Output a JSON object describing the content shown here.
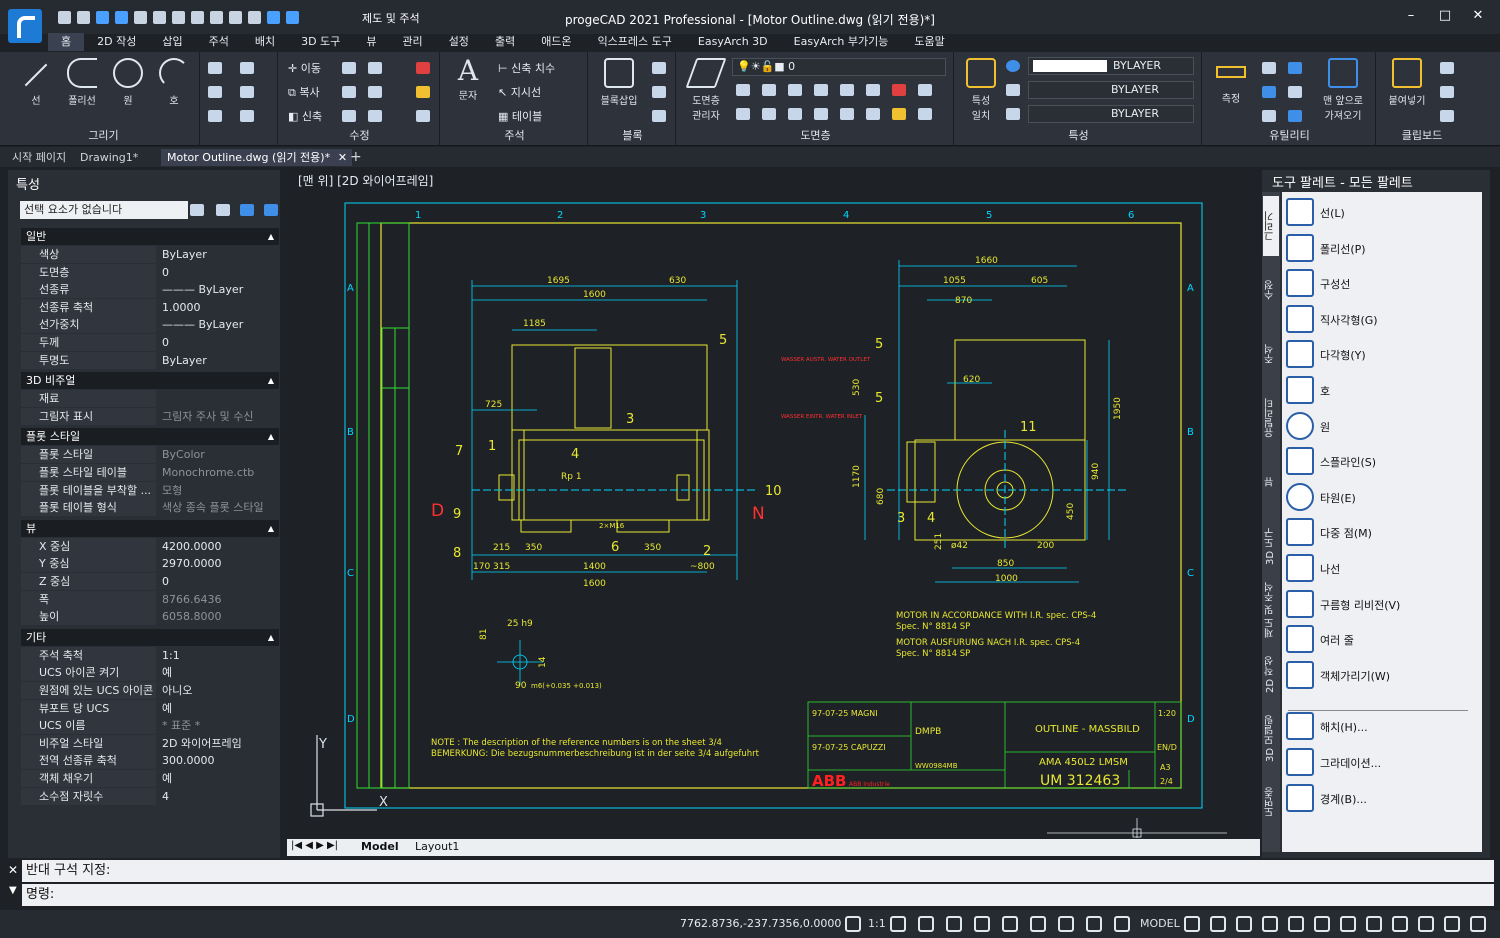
{
  "titlebar": {
    "app_title": "progeCAD 2021 Professional - [Motor Outline.dwg (읽기 전용)*]",
    "quick_label": "제도 및 주석",
    "minimize": "–",
    "maximize": "□",
    "close": "✕"
  },
  "menu_tabs": [
    "홈",
    "2D 작성",
    "삽입",
    "주석",
    "배치",
    "3D 도구",
    "뷰",
    "관리",
    "설정",
    "출력",
    "애드온",
    "익스프레스 도구",
    "EasyArch 3D",
    "EasyArch 부가기능",
    "도움말"
  ],
  "ribbon": {
    "draw": {
      "title": "그리기",
      "line": "선",
      "polyline": "폴리선",
      "circle": "원",
      "arc": "호"
    },
    "modify": {
      "title": "수정",
      "move": "이동",
      "copy": "복사",
      "stretch": "신축"
    },
    "annotation": {
      "title": "주석",
      "text": "문자",
      "dim": "신축 치수",
      "leader": "지시선",
      "table": "테이블"
    },
    "block": {
      "title": "블록",
      "insert": "블록삽입"
    },
    "layers": {
      "title": "도면층",
      "manager": "도면층\n관리자",
      "current": "0"
    },
    "properties": {
      "title": "특성",
      "match": "특성\n일치",
      "color": "BYLAYER",
      "linetype": "BYLAYER",
      "lineweight": "BYLAYER"
    },
    "utilities": {
      "title": "유틸리티",
      "measure": "측정",
      "paste_from": "맨 앞으로\n가져오기"
    },
    "clipboard": {
      "title": "클립보드",
      "paste": "붙여넣기"
    }
  },
  "doc_tabs": [
    "시작 페이지",
    "Drawing1*",
    "Motor Outline.dwg (읽기 전용)*"
  ],
  "properties": {
    "title": "특성",
    "selection": "선택 요소가 없습니다",
    "sections": [
      {
        "name": "일반",
        "rows": [
          [
            "색상",
            "ByLayer"
          ],
          [
            "도면층",
            "0"
          ],
          [
            "선종류",
            "——— ByLayer"
          ],
          [
            "선종류 축척",
            "1.0000"
          ],
          [
            "선가중치",
            "——— ByLayer"
          ],
          [
            "두께",
            "0"
          ],
          [
            "투명도",
            "ByLayer"
          ]
        ]
      },
      {
        "name": "3D 비주얼",
        "rows": [
          [
            "재료",
            ""
          ],
          [
            "그림자 표시",
            "그림자 주사 및 수신"
          ]
        ]
      },
      {
        "name": "플롯 스타일",
        "rows": [
          [
            "플롯 스타일",
            "ByColor"
          ],
          [
            "플롯 스타일 테이블",
            "Monochrome.ctb"
          ],
          [
            "플롯 테이블을 부착할 ...",
            "모형"
          ],
          [
            "플롯 테이블 형식",
            "색상 종속 플롯 스타일"
          ]
        ]
      },
      {
        "name": "뷰",
        "rows": [
          [
            "X 중심",
            "4200.0000"
          ],
          [
            "Y 중심",
            "2970.0000"
          ],
          [
            "Z 중심",
            "0"
          ],
          [
            "폭",
            "8766.6436"
          ],
          [
            "높이",
            "6058.8000"
          ]
        ]
      },
      {
        "name": "기타",
        "rows": [
          [
            "주석 축척",
            "1:1"
          ],
          [
            "UCS 아이콘 켜기",
            "예"
          ],
          [
            "원점에 있는 UCS 아이콘",
            "아니오"
          ],
          [
            "뷰포트 당 UCS",
            "예"
          ],
          [
            "UCS 이름",
            "* 표준 *"
          ],
          [
            "비주얼 스타일",
            "2D 와이어프레임"
          ],
          [
            "전역 선종류 축척",
            "300.0000"
          ],
          [
            "객체 채우기",
            "예"
          ],
          [
            "소수점 자릿수",
            "4"
          ]
        ]
      }
    ]
  },
  "viewport": {
    "label": "[맨 위] [2D 와이어프레임]"
  },
  "drawing": {
    "zone_numbers": [
      "1",
      "2",
      "3",
      "4",
      "5",
      "6"
    ],
    "zone_letters": [
      "A",
      "B",
      "C",
      "D"
    ],
    "dims_front": [
      "1695",
      "630",
      "1600",
      "1185",
      "725",
      "215",
      "350",
      "350",
      "170",
      "315",
      "1400",
      "1600",
      "~800"
    ],
    "dims_side": [
      "1660",
      "1055",
      "605",
      "870",
      "620",
      "530",
      "1950",
      "1170",
      "680",
      "940",
      "450",
      "251",
      "ø42",
      "200",
      "850",
      "1000"
    ],
    "callouts_front": [
      "5",
      "3",
      "4",
      "7",
      "1",
      "6",
      "2",
      "9",
      "8",
      "10"
    ],
    "callouts_side": [
      "5",
      "5",
      "11",
      "3",
      "4"
    ],
    "marker_d": "D",
    "marker_n": "N",
    "water_out": "WASSER AUSTR. WATER OUTLET",
    "water_in": "WASSER EINTR. WATER INLET",
    "rp": "Rp 1",
    "m16": "2×M16",
    "shaft_dims": [
      "25 h9",
      "81",
      "14",
      "90",
      "m6(+0.035 +0.013)"
    ],
    "note1": "MOTOR IN ACCORDANCE WITH I.R. spec. CPS-4",
    "note1b": "Spec. N° 8814 SP",
    "note2": "MOTOR AUSFURUNG NACH I.R. spec. CPS-4",
    "note2b": "Spec. N° 8814 SP",
    "note3": "NOTE : The description of the reference numbers is on the sheet 3/4",
    "note3b": "BEMERKUNG: Die bezugsnummerbeschreibung ist in der seite 3/4 aufgefuhrt",
    "tb_title": "OUTLINE - MASSBILD",
    "tb_type": "AMA 450L2 LMSM",
    "tb_docno": "UM 312463",
    "tb_date1": "97-07-25 MAGNI",
    "tb_date2": "97-07-25 CAPUZZI",
    "tb_dept": "DMPB",
    "tb_order": "WW0984MB",
    "tb_scale": "1:20",
    "tb_size": "A3",
    "tb_lang": "EN/D",
    "tb_sheet": "2/4",
    "tb_abb": "ABB",
    "tb_abb_sub": "ABB Industrie"
  },
  "layout_tabs": [
    "Model",
    "Layout1"
  ],
  "tool_palette": {
    "title": "도구 팔레트 - 모든 팔레트",
    "tabs": [
      "그리기",
      "수정",
      "주석",
      "유틸리티",
      "뷰",
      "3D 도구",
      "제도 및 주석",
      "2D 작성",
      "3D 모델링",
      "도면층"
    ],
    "items": [
      "선(L)",
      "폴리선(P)",
      "구성선",
      "직사각형(G)",
      "다각형(Y)",
      "호",
      "원",
      "스플라인(S)",
      "타원(E)",
      "다중 점(M)",
      "나선",
      "구름형 리비전(V)",
      "여러 줄",
      "객체가리기(W)",
      "해치(H)...",
      "그라데이션...",
      "경계(B)..."
    ]
  },
  "command": {
    "history": "반대 구석 지정:",
    "prompt": "명령:"
  },
  "status": {
    "coords": "7762.8736,-237.7356,0.0000",
    "scale": "1:1",
    "model": "MODEL"
  }
}
